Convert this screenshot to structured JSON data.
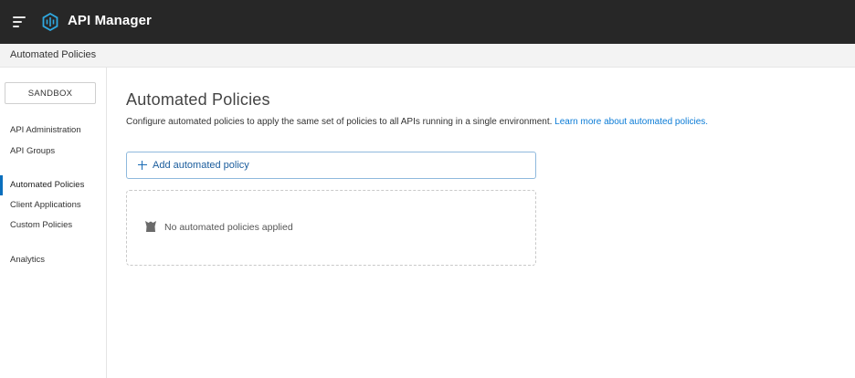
{
  "header": {
    "app_title": "API Manager"
  },
  "breadcrumb": {
    "label": "Automated Policies"
  },
  "sidebar": {
    "environment": "SANDBOX",
    "items": [
      {
        "label": "API Administration"
      },
      {
        "label": "API Groups"
      },
      {
        "label": "Automated Policies",
        "active": true
      },
      {
        "label": "Client Applications"
      },
      {
        "label": "Custom Policies"
      },
      {
        "label": "Analytics"
      }
    ]
  },
  "main": {
    "title": "Automated Policies",
    "description": "Configure automated policies to apply the same set of policies to all APIs running in a single environment.",
    "learn_more_link": "Learn more about automated policies.",
    "add_button_label": "Add automated policy",
    "empty_state_text": "No automated policies applied"
  },
  "colors": {
    "topbar": "#272727",
    "accent": "#0a6fbd",
    "link": "#0a7bd6"
  }
}
